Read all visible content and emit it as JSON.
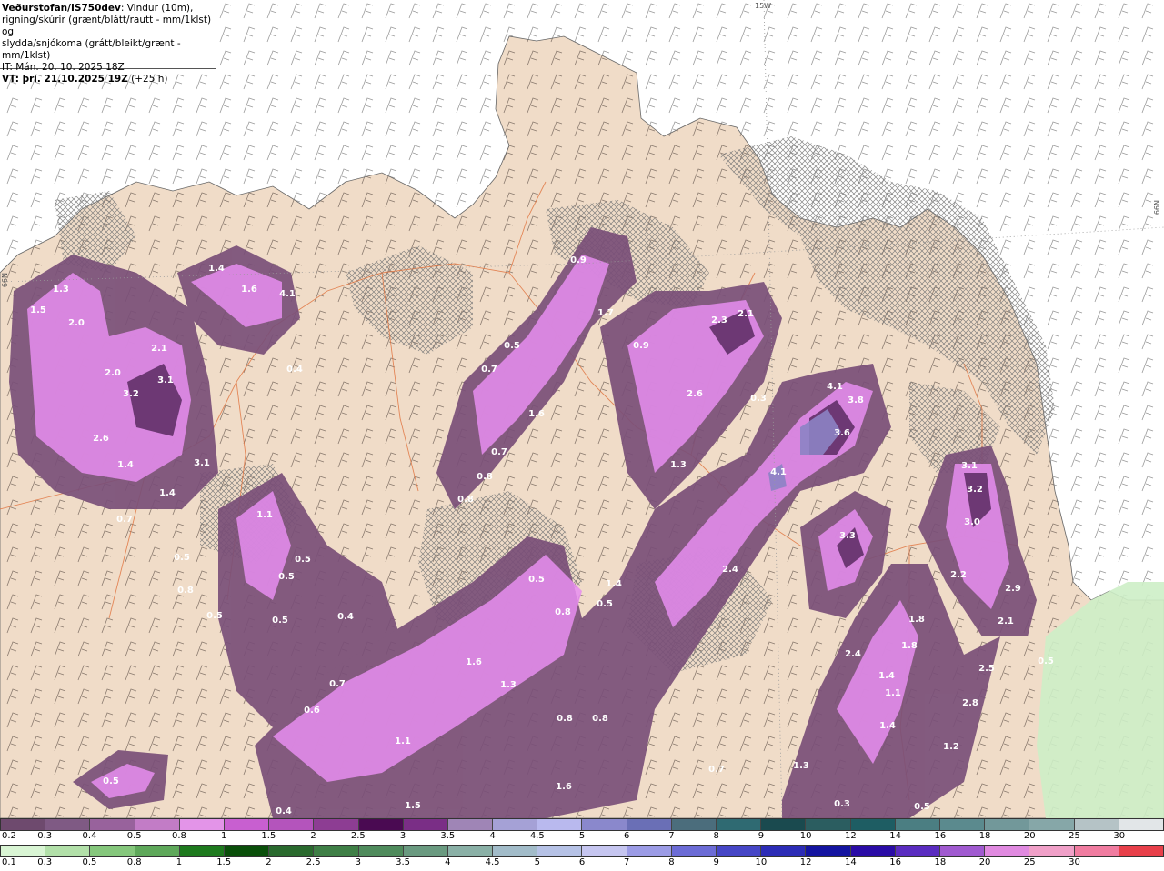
{
  "header": {
    "source": "Veðurstofan/IS750dev",
    "line1_rest": ": Vindur (10m),",
    "line2": "rigning/skúrir (grænt/blátt/rautt - mm/1klst) og",
    "line3": "slydda/snjókoma (grátt/bleikt/grænt - mm/1klst)",
    "it": "IT: Mán. 20. 10. 2025 18Z",
    "vt": "VT: þri. 21.10.2025 19Z",
    "vt_offset": "(+25 h)"
  },
  "graticule_labels": {
    "lon_top": "15W",
    "lat_left": "66N",
    "lat_right": "66N"
  },
  "map_labels": [
    "1.3",
    "1.5",
    "2.0",
    "1.4",
    "1.6",
    "4.1",
    "0.4",
    "2.1",
    "2.0",
    "3.2",
    "3.1",
    "2.6",
    "1.4",
    "3.1",
    "1.4",
    "0.7",
    "0.9",
    "1.7",
    "0.5",
    "0.7",
    "0.9",
    "2.3",
    "2.1",
    "2.6",
    "0.3",
    "4.1",
    "3.8",
    "3.6",
    "1.6",
    "0.7",
    "0.8",
    "0.8",
    "1.3",
    "4.1",
    "3.1",
    "3.2",
    "3.0",
    "1.1",
    "0.5",
    "0.8",
    "0.5",
    "0.5",
    "0.5",
    "0.5",
    "0.4",
    "0.5",
    "1.4",
    "0.5",
    "3.3",
    "2.4",
    "2.2",
    "2.9",
    "2.1",
    "1.8",
    "0.8",
    "1.8",
    "1.4",
    "2.4",
    "0.5",
    "0.7",
    "1.6",
    "1.3",
    "0.6",
    "1.1",
    "0.8",
    "0.8",
    "1.6",
    "1.1",
    "1.4",
    "2.5",
    "2.8",
    "1.2",
    "0.7",
    "1.3",
    "1.5",
    "0.4",
    "0.3",
    "0.5",
    "0.5"
  ],
  "legend_snow": {
    "colors": [
      "#6e4a6e",
      "#7f5a84",
      "#98629c",
      "#c27cc6",
      "#e394e8",
      "#c85fd0",
      "#b454bc",
      "#8d3d93",
      "#4a0a52",
      "#7a2e86",
      "#9f85b6",
      "#a5a1d6",
      "#b9b9ee",
      "#8a88cc",
      "#6a6fb6",
      "#4b6d7c",
      "#2f6a72",
      "#1a4a4f",
      "#2b5d60",
      "#1e5d63",
      "#4b7e82",
      "#5b8a8e",
      "#72989a",
      "#86a7a8",
      "#b5c3c6",
      "#e2e6e8"
    ],
    "labels": [
      "0.2",
      "0.3",
      "0.4",
      "0.5",
      "0.8",
      "1",
      "1.5",
      "2",
      "2.5",
      "3",
      "3.5",
      "4",
      "4.5",
      "5",
      "6",
      "7",
      "8",
      "9",
      "10",
      "12",
      "14",
      "16",
      "18",
      "20",
      "25",
      "30"
    ]
  },
  "legend_rain": {
    "colors": [
      "#d9f5d4",
      "#b2e0a9",
      "#85c77c",
      "#5ea85a",
      "#1e7a1e",
      "#0a4f0a",
      "#2a6a2e",
      "#3f7f46",
      "#4f8b5c",
      "#6a9a80",
      "#8ab0a6",
      "#a2bcc9",
      "#b6c2e6",
      "#c6c6f0",
      "#9c9ce6",
      "#6c6cd6",
      "#4646c6",
      "#2c2cb6",
      "#1414a0",
      "#2a0ca6",
      "#5a2cc0",
      "#a05ad0",
      "#e08ae0",
      "#f0a0c8",
      "#f07ca0",
      "#e8404a"
    ],
    "labels": [
      "0.1",
      "0.3",
      "0.5",
      "0.8",
      "1",
      "1.5",
      "2",
      "2.5",
      "3",
      "3.5",
      "4",
      "4.5",
      "5",
      "6",
      "7",
      "8",
      "9",
      "10",
      "12",
      "14",
      "16",
      "18",
      "20",
      "25",
      "30"
    ]
  }
}
